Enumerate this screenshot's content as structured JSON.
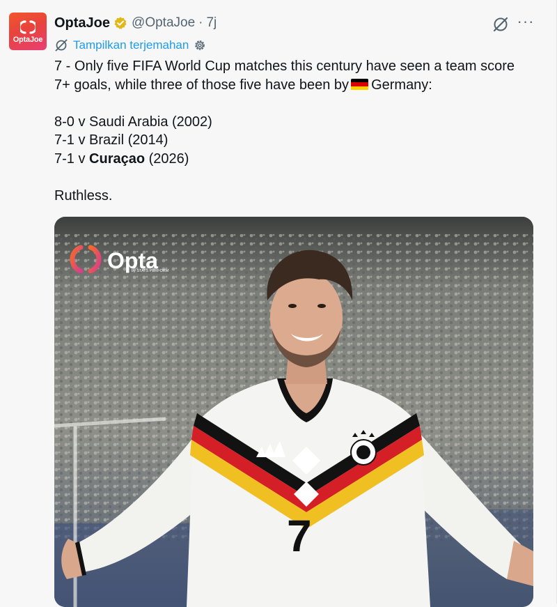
{
  "tweet": {
    "avatar_label": "OptaJoe",
    "display_name": "OptaJoe",
    "handle": "@OptaJoe",
    "separator": "·",
    "time": "7j",
    "translate_label": "Tampilkan terjemahan",
    "more_label": "···",
    "lines": {
      "l1": "7 - Only five FIFA World Cup matches this century have seen a team score",
      "l2a": "7+ goals, while three of those five have been by",
      "l2b": "Germany:",
      "l3": "8-0 v Saudi Arabia (2002)",
      "l4": "7-1 v Brazil (2014)",
      "l5a": "7-1 v",
      "l5b": "Curaçao",
      "l5c": "(2026)",
      "l6": "Ruthless."
    }
  },
  "media": {
    "brand_name": "Opta",
    "brand_sub": "by STATS PERFORM",
    "shirt_number": "7"
  },
  "colors": {
    "accent_link": "#1d9bf0",
    "text_secondary": "#536471",
    "verified_gold": "#e2b719",
    "flag": [
      "#000000",
      "#dd0000",
      "#ffce00"
    ]
  },
  "icons": [
    "verified-badge-icon",
    "grok-icon",
    "more-icon",
    "translate-icon",
    "settings-icon"
  ]
}
